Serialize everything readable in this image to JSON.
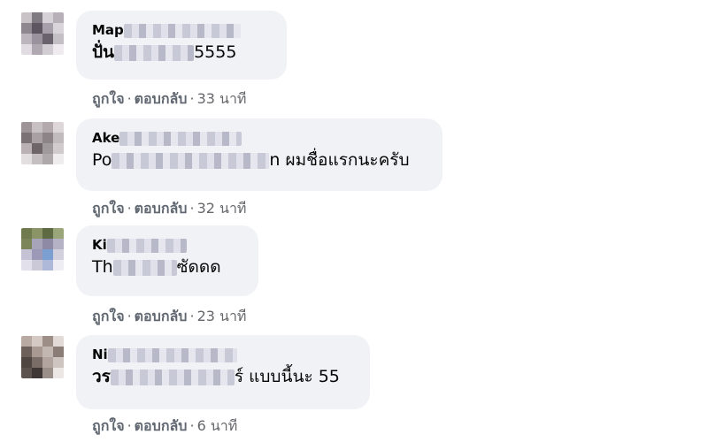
{
  "colors": {
    "bubble_bg": "#f0f2f5",
    "action_text": "#65676b",
    "text": "#050505"
  },
  "comments": [
    {
      "author_visible": "Map",
      "text_prefix": "ปั่น",
      "text_suffix": "5555",
      "like": "ถูกใจ",
      "reply": "ตอบกลับ",
      "time": "33 นาที"
    },
    {
      "author_visible": "Ake",
      "text_prefix": "Po",
      "text_suffix": "n ผมชื่อแรกนะครับ",
      "like": "ถูกใจ",
      "reply": "ตอบกลับ",
      "time": "32 นาที"
    },
    {
      "author_visible": "Ki",
      "text_prefix": "Th",
      "text_suffix": "ซัดดด",
      "like": "ถูกใจ",
      "reply": "ตอบกลับ",
      "time": "23 นาที"
    },
    {
      "author_visible": "Ni",
      "text_prefix": "วร",
      "text_suffix": "ร์ แบบนี้นะ 55",
      "like": "ถูกใจ",
      "reply": "ตอบกลับ",
      "time": "6 นาที"
    }
  ]
}
